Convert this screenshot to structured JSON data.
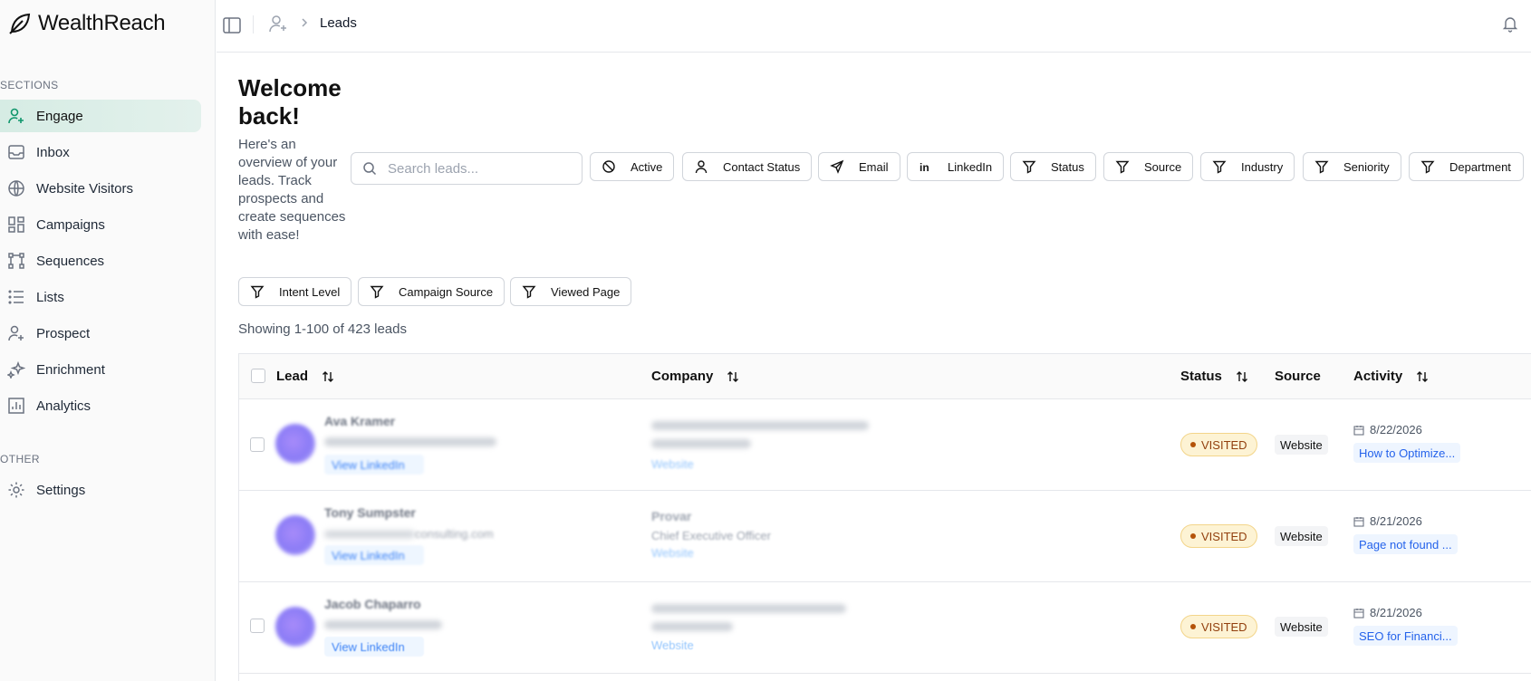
{
  "app": {
    "name": "WealthReach"
  },
  "sidebar": {
    "sections_label": "SECTIONS",
    "items": [
      {
        "label": "Engage",
        "icon": "user-plus-icon",
        "active": true
      },
      {
        "label": "Inbox",
        "icon": "inbox-icon"
      },
      {
        "label": "Website Visitors",
        "icon": "globe-icon"
      },
      {
        "label": "Campaigns",
        "icon": "grid-icon"
      },
      {
        "label": "Sequences",
        "icon": "sequence-icon"
      },
      {
        "label": "Lists",
        "icon": "list-icon"
      },
      {
        "label": "Prospect",
        "icon": "user-plus-icon"
      },
      {
        "label": "Enrichment",
        "icon": "sparkles-icon"
      },
      {
        "label": "Analytics",
        "icon": "bar-chart-icon"
      }
    ],
    "other_label": "OTHER",
    "other_items": [
      {
        "label": "Settings",
        "icon": "gear-icon"
      }
    ]
  },
  "header": {
    "breadcrumb_current": "Leads"
  },
  "main": {
    "welcome": "Welcome back!",
    "subtitle": "Here's an overview of your leads. Track prospects and create sequences with ease!",
    "search_placeholder": "Search leads...",
    "filters": [
      "Active",
      "Contact Status",
      "Email",
      "LinkedIn",
      "Status",
      "Source",
      "Industry",
      "Seniority",
      "Department",
      "Intent Level",
      "Campaign Source",
      "Viewed Page"
    ],
    "showing": "Showing 1-100 of 423 leads"
  },
  "table": {
    "columns": [
      "Lead",
      "Company",
      "Status",
      "Source",
      "Activity"
    ],
    "rows": [
      {
        "name": "Ava Kramer",
        "email": "",
        "company": "",
        "company_title": "",
        "status": "VISITED",
        "source": "Website",
        "date": "8/22/2026",
        "page": "How to Optimize..."
      },
      {
        "name": "Tony Sumpster",
        "email": "consulting.com",
        "company": "Provar",
        "company_title": "Chief Executive Officer",
        "status": "VISITED",
        "source": "Website",
        "date": "8/21/2026",
        "page": "Page not found ..."
      },
      {
        "name": "Jacob Chaparro",
        "email": "",
        "company": "",
        "company_title": "",
        "status": "VISITED",
        "source": "Website",
        "date": "8/21/2026",
        "page": "SEO for Financi..."
      }
    ],
    "linkedin_label": "View LinkedIn",
    "website_label": "Website"
  }
}
